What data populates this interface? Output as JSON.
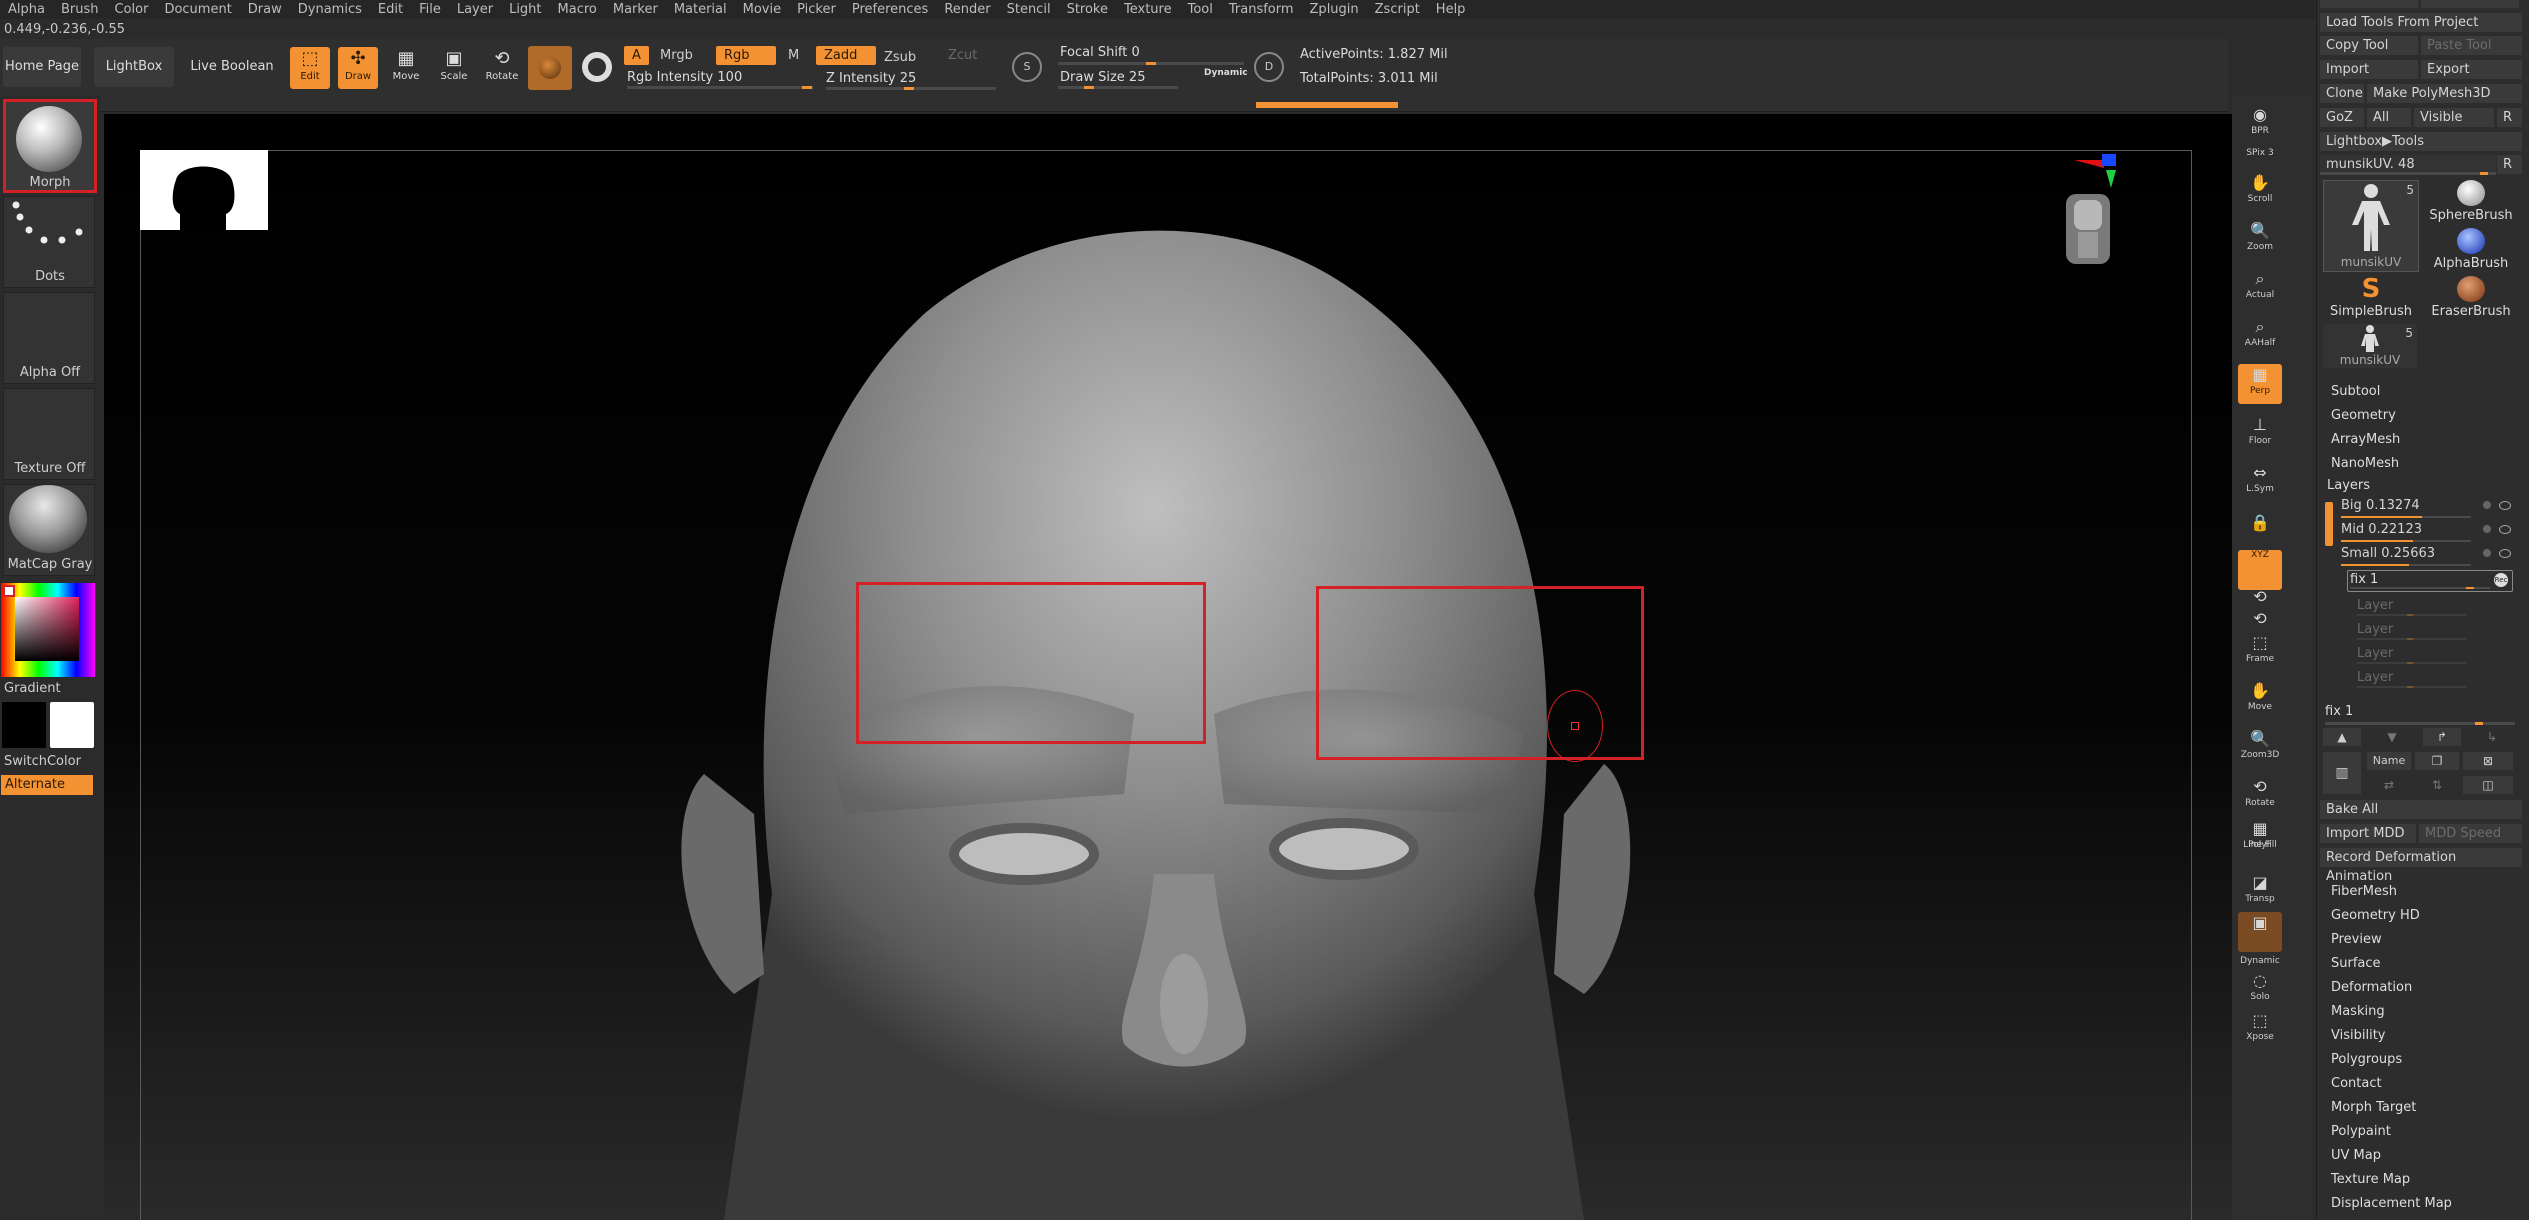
{
  "menu": [
    "Alpha",
    "Brush",
    "Color",
    "Document",
    "Draw",
    "Dynamics",
    "Edit",
    "File",
    "Layer",
    "Light",
    "Macro",
    "Marker",
    "Material",
    "Movie",
    "Picker",
    "Preferences",
    "Render",
    "Stencil",
    "Stroke",
    "Texture",
    "Tool",
    "Transform",
    "Zplugin",
    "Zscript",
    "Help"
  ],
  "coords": "0.449,-0.236,-0.55",
  "toolbar": {
    "home_page": "Home Page",
    "lightbox": "LightBox",
    "live_boolean": "Live Boolean",
    "edit": "Edit",
    "draw": "Draw",
    "move": "Move",
    "scale": "Scale",
    "rotate": "Rotate",
    "a": "A",
    "mrgb": "Mrgb",
    "rgb": "Rgb",
    "m": "M",
    "rgb_intensity_label": "Rgb Intensity",
    "rgb_intensity_value": "100",
    "zadd": "Zadd",
    "zsub": "Zsub",
    "zcut": "Zcut",
    "z_intensity_label": "Z Intensity",
    "z_intensity_value": "25",
    "focal_shift_label": "Focal Shift",
    "focal_shift_value": "0",
    "draw_size_label": "Draw Size",
    "draw_size_value": "25",
    "dynamic": "Dynamic",
    "active_points": "ActivePoints: 1.827 Mil",
    "total_points": "TotalPoints: 3.011 Mil"
  },
  "left_shelf": {
    "brush": "Morph",
    "stroke": "Dots",
    "alpha": "Alpha Off",
    "texture": "Texture Off",
    "material": "MatCap Gray",
    "gradient": "Gradient",
    "switch_color": "SwitchColor",
    "alternate": "Alternate"
  },
  "right_shelf": [
    "BPR",
    "SPix 3",
    "Scroll",
    "Zoom",
    "Actual",
    "AAHalf",
    "Perp",
    "Floor",
    "L.Sym",
    "",
    "XYZ",
    "",
    "",
    "Frame",
    "Move",
    "Zoom3D",
    "Rotate",
    "Line Fill",
    "PolyF",
    "Transp",
    "",
    "Dynamic",
    "Solo",
    "Xpose"
  ],
  "tool_panel": {
    "load_tools": "Load Tools From Project",
    "copy_tool": "Copy Tool",
    "paste_tool": "Paste Tool",
    "import": "Import",
    "export": "Export",
    "clone": "Clone",
    "make_polymesh": "Make PolyMesh3D",
    "goz": "GoZ",
    "all": "All",
    "visible": "Visible",
    "r": "R",
    "lightbox_tools": "Lightbox▶Tools",
    "current_tool": "munsikUV. 48",
    "tools": [
      {
        "name": "munsikUV",
        "count": "5"
      },
      {
        "name": "SphereBrush",
        "count": ""
      },
      {
        "name": "AlphaBrush",
        "count": ""
      },
      {
        "name": "SimpleBrush",
        "count": ""
      },
      {
        "name": "EraserBrush",
        "count": ""
      },
      {
        "name": "munsikUV",
        "count": "5"
      }
    ],
    "sections_top": [
      "Subtool",
      "Geometry",
      "ArrayMesh",
      "NanoMesh"
    ],
    "layers_title": "Layers",
    "layers": [
      {
        "name": "Big",
        "value": "0.13274",
        "fill": 0.62
      },
      {
        "name": "Mid",
        "value": "0.22123",
        "fill": 0.55
      },
      {
        "name": "Small",
        "value": "0.25663",
        "fill": 0.52
      },
      {
        "name": "fix",
        "value": "1",
        "fill": 0.78
      }
    ],
    "empty_layers": [
      "Layer",
      "Layer",
      "Layer",
      "Layer"
    ],
    "rec": "Rec",
    "fix_slider_label": "fix 1",
    "name_btn": "Name",
    "bake_all": "Bake All",
    "import_mdd": "Import MDD",
    "mdd_speed": "MDD Speed",
    "record_deformation": "Record Deformation Animation",
    "sections_bottom": [
      "FiberMesh",
      "Geometry HD",
      "Preview",
      "Surface",
      "Deformation",
      "Masking",
      "Visibility",
      "Polygroups",
      "Contact",
      "Morph Target",
      "Polypaint",
      "UV Map",
      "Texture Map",
      "Displacement Map"
    ]
  },
  "colors": {
    "accent": "#f39233",
    "highlight": "#d42027"
  }
}
